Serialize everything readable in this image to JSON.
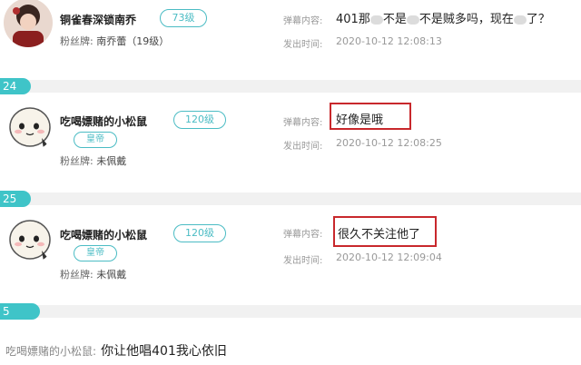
{
  "entries": [
    {
      "username": "铜雀春深锁南乔",
      "level": "73级",
      "fan_label": "粉丝牌:",
      "fan_value": "南乔蕾（19级）",
      "danmu_label": "弹幕内容:",
      "danmu_text_parts": [
        "401那",
        "不是",
        "不是贼多吗，现在",
        "了？"
      ],
      "time_label": "发出时间:",
      "time_value": "2020-10-12 12:08:13"
    },
    {
      "number": "24",
      "username": "吃喝嫖赌的小松鼠",
      "level": "120级",
      "badge": "皇帝",
      "fan_label": "粉丝牌:",
      "fan_value": "未佩戴",
      "danmu_label": "弹幕内容:",
      "danmu_text": "好像是哦",
      "time_label": "发出时间:",
      "time_value": "2020-10-12 12:08:25"
    },
    {
      "number": "25",
      "username": "吃喝嫖赌的小松鼠",
      "level": "120级",
      "badge": "皇帝",
      "fan_label": "粉丝牌:",
      "fan_value": "未佩戴",
      "danmu_label": "弹幕内容:",
      "danmu_text": "很久不关注他了",
      "time_label": "发出时间:",
      "time_value": "2020-10-12 12:09:04"
    }
  ],
  "tab_5": "5",
  "bottom": {
    "who": "吃喝嫖赌的小松鼠:",
    "msg": "你让他唱401我心依旧"
  },
  "colors": {
    "accent": "#3fc4c8",
    "highlight_box": "#c8282c"
  }
}
